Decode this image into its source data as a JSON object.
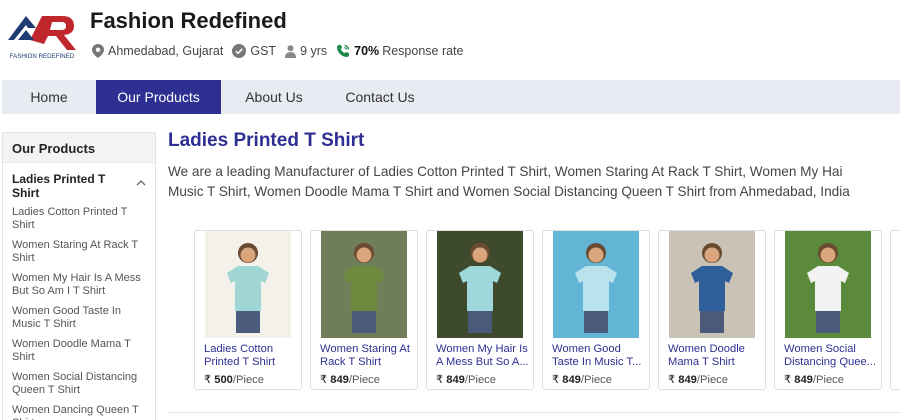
{
  "header": {
    "brand": "Fashion Redefined",
    "logo_text": "FASHION REDEFINED",
    "location": "Ahmedabad, Gujarat",
    "gst": "GST",
    "years": "9 yrs",
    "response_rate": "70%",
    "response_label": "Response rate"
  },
  "nav": {
    "items": [
      {
        "label": "Home"
      },
      {
        "label": "Our Products"
      },
      {
        "label": "About Us"
      },
      {
        "label": "Contact Us"
      }
    ],
    "active": "Our Products"
  },
  "sidebar": {
    "heading": "Our Products",
    "category": "Ladies Printed T Shirt",
    "items": [
      "Ladies Cotton Printed T Shirt",
      "Women Staring At Rack T Shirt",
      "Women My Hair Is A Mess But So Am I T Shirt",
      "Women Good Taste In Music T Shirt",
      "Women Doodle Mama T Shirt",
      "Women Social Distancing Queen T Shirt",
      "Women Dancing Queen T Shirt"
    ]
  },
  "main": {
    "title": "Ladies Printed T Shirt",
    "description_line1": "We are a leading Manufacturer of Ladies Cotton Printed T Shirt, Women Staring At Rack T Shirt, Women My Hai",
    "description_line2": "Music T Shirt, Women Doodle Mama T Shirt and Women Social Distancing Queen T Shirt from Ahmedabad, India"
  },
  "products": [
    {
      "name1": "Ladies Cotton",
      "name2": "Printed T Shirt",
      "currency": "₹",
      "price": "500",
      "unit": "/Piece",
      "bg": "#f4f0ea",
      "shirt": "#9fd6d4"
    },
    {
      "name1": "Women Staring At",
      "name2": "Rack T Shirt",
      "currency": "₹",
      "price": "849",
      "unit": "/Piece",
      "bg": "#6f7e58",
      "shirt": "#6e8a3e"
    },
    {
      "name1": "Women My Hair Is",
      "name2": "A Mess But So A...",
      "currency": "₹",
      "price": "849",
      "unit": "/Piece",
      "bg": "#3e4a2e",
      "shirt": "#9fd8da"
    },
    {
      "name1": "Women Good",
      "name2": "Taste In Music T...",
      "currency": "₹",
      "price": "849",
      "unit": "/Piece",
      "bg": "#63b5d6",
      "shirt": "#b9e2ec"
    },
    {
      "name1": "Women Doodle",
      "name2": "Mama T Shirt",
      "currency": "₹",
      "price": "849",
      "unit": "/Piece",
      "bg": "#c9c2b6",
      "shirt": "#2e5f9a"
    },
    {
      "name1": "Women Social",
      "name2": "Distancing Quee...",
      "currency": "₹",
      "price": "849",
      "unit": "/Piece",
      "bg": "#5b8a3c",
      "shirt": "#f2f2f2"
    }
  ],
  "colors": {
    "brand_blue": "#2d3092",
    "nav_bg": "#e9ebf3",
    "logo_red": "#c0272d",
    "logo_navy": "#1f3b73",
    "verified_green": "#1a8a4a"
  }
}
